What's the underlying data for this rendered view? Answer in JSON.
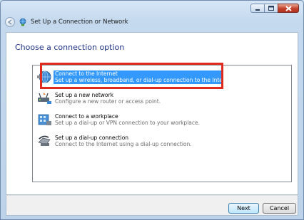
{
  "window": {
    "title": "Set Up a Connection or Network",
    "controls": [
      "minimize-icon",
      "maximize-icon",
      "close-icon"
    ]
  },
  "main": {
    "heading": "Choose a connection option",
    "options": [
      {
        "title": "Connect to the Internet",
        "description": "Set up a wireless, broadband, or dial-up connection to the Internet.",
        "icon": "globe-network-icon",
        "selected": true
      },
      {
        "title": "Set up a new network",
        "description": "Configure a new router or access point.",
        "icon": "router-icon",
        "selected": false
      },
      {
        "title": "Connect to a workplace",
        "description": "Set up a dial-up or VPN connection to your workplace.",
        "icon": "workplace-icon",
        "selected": false
      },
      {
        "title": "Set up a dial-up connection",
        "description": "Connect to the Internet using a dial-up connection.",
        "icon": "modem-phone-icon",
        "selected": false
      }
    ]
  },
  "footer": {
    "next_label": "Next",
    "cancel_label": "Cancel"
  },
  "colors": {
    "selection": "#3399ff",
    "highlight_box": "#e02a1d",
    "heading": "#1e3287"
  }
}
